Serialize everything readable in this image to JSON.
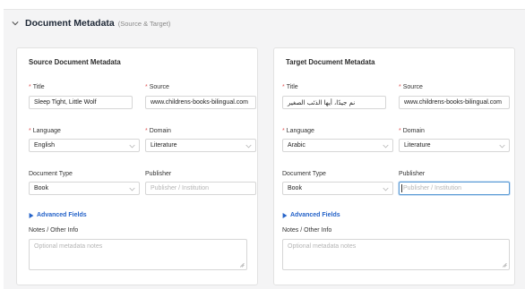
{
  "section": {
    "title": "Document Metadata",
    "subtitle": "(Source & Target)"
  },
  "source": {
    "heading": "Source Document Metadata",
    "title_label": "Title",
    "title_value": "Sleep Tight, Little Wolf",
    "source_label": "Source",
    "source_value": "www.childrens-books-bilingual.com",
    "language_label": "Language",
    "language_value": "English",
    "domain_label": "Domain",
    "domain_value": "Literature",
    "doctype_label": "Document Type",
    "doctype_value": "Book",
    "publisher_label": "Publisher",
    "publisher_placeholder": "Publisher / Institution",
    "advanced_label": "Advanced Fields",
    "notes_label": "Notes / Other Info",
    "notes_placeholder": "Optional metadata notes"
  },
  "target": {
    "heading": "Target Document Metadata",
    "title_label": "Title",
    "title_value": "نم جيدًا، أيها الذئب الصغير",
    "source_label": "Source",
    "source_value": "www.childrens-books-bilingual.com",
    "language_label": "Language",
    "language_value": "Arabic",
    "domain_label": "Domain",
    "domain_value": "Literature",
    "doctype_label": "Document Type",
    "doctype_value": "Book",
    "publisher_label": "Publisher",
    "publisher_placeholder": "Publisher / Institution",
    "advanced_label": "Advanced Fields",
    "notes_label": "Notes / Other Info",
    "notes_placeholder": "Optional metadata notes"
  },
  "colors": {
    "required": "#e05555",
    "link": "#2563c9",
    "focus": "#5b9bd5"
  }
}
